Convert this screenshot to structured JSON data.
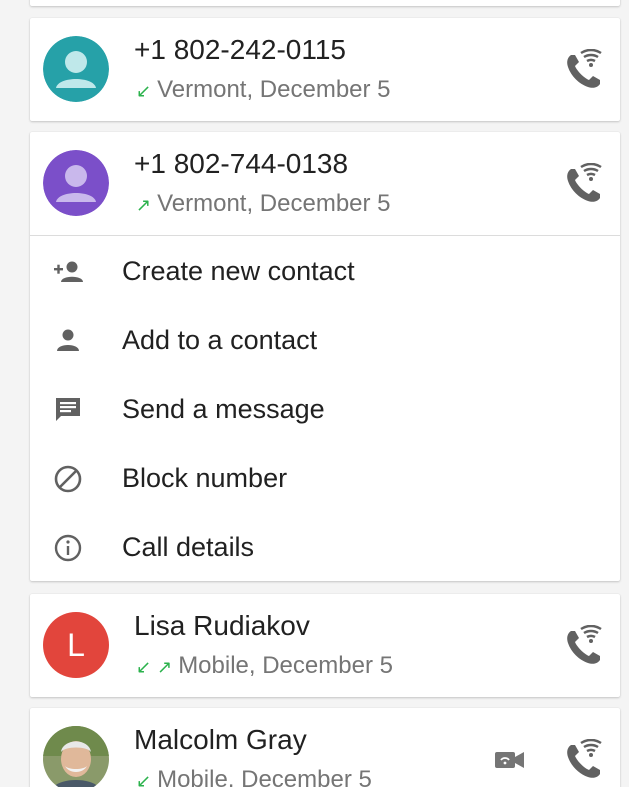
{
  "calls": [
    {
      "number": "+1 802-242-0115",
      "direction_icon": "incoming-arrow-icon",
      "direction_glyph": "↙",
      "detail": "Vermont, December 5",
      "avatar_color": "#26a1a8"
    },
    {
      "number": "+1 802-744-0138",
      "direction_icon": "outgoing-arrow-icon",
      "direction_glyph": "↗",
      "detail": "Vermont, December 5",
      "avatar_color": "#7b4fc9"
    },
    {
      "name": "Lisa Rudiakov",
      "avatar_letter": "L",
      "avatar_color": "#e2453c",
      "direction_glyph_1": "↙",
      "direction_glyph_2": "↗",
      "detail": "Mobile, December 5"
    },
    {
      "name": "Malcolm Gray",
      "direction_glyph": "↙",
      "detail": "Mobile, December 5"
    }
  ],
  "menu": {
    "create_contact": "Create new contact",
    "add_to_contact": "Add to a contact",
    "send_message": "Send a message",
    "block_number": "Block number",
    "call_details": "Call details"
  },
  "colors": {
    "icon_gray": "#616161",
    "call_arrow_green": "#2bb24c",
    "text_primary": "#212121",
    "text_secondary": "#757575"
  }
}
